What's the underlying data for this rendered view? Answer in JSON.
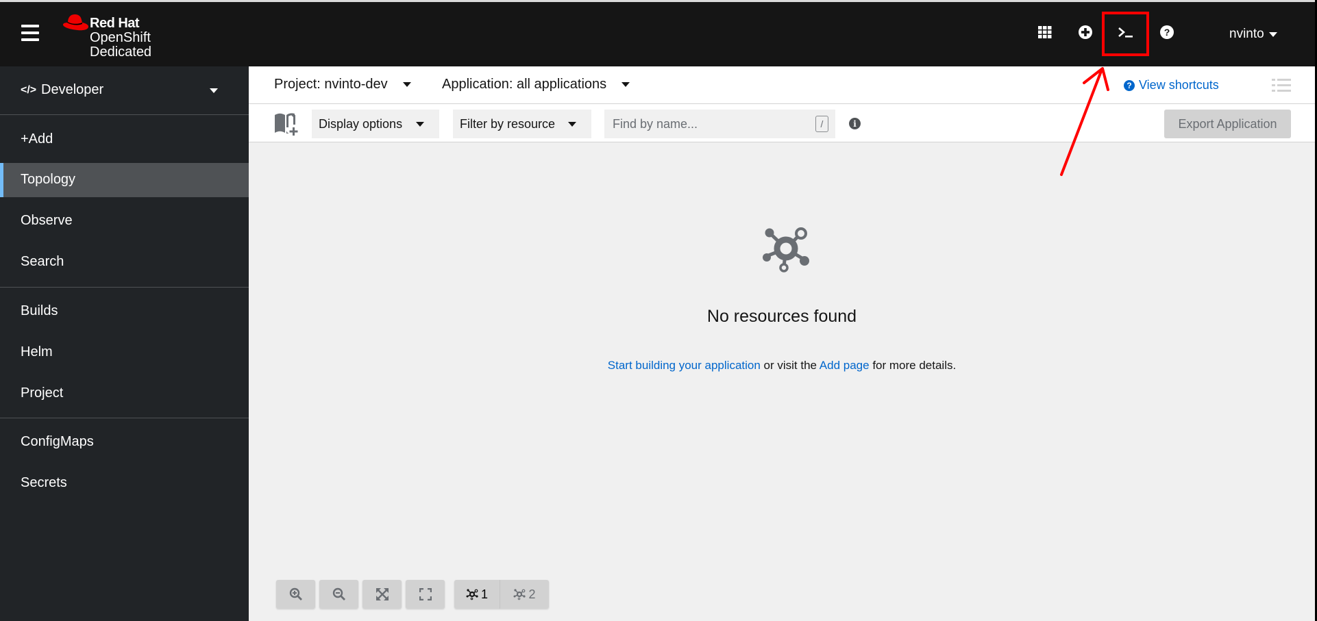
{
  "masthead": {
    "brand": "Red Hat",
    "product": "OpenShift",
    "edition": "Dedicated",
    "icons": [
      "app-launcher-icon",
      "import-add-icon",
      "cloud-shell-terminal-icon",
      "help-icon"
    ],
    "user": "nvinto"
  },
  "sidebar": {
    "perspective": "Developer",
    "items": [
      {
        "label": "+Add",
        "active": false
      },
      {
        "label": "Topology",
        "active": true
      },
      {
        "label": "Observe",
        "active": false
      },
      {
        "label": "Search",
        "active": false
      },
      {
        "label": "Builds",
        "active": false
      },
      {
        "label": "Helm",
        "active": false
      },
      {
        "label": "Project",
        "active": false
      },
      {
        "label": "ConfigMaps",
        "active": false
      },
      {
        "label": "Secrets",
        "active": false
      }
    ]
  },
  "context": {
    "project": "Project: nvinto-dev",
    "application": "Application: all applications",
    "shortcuts": "View shortcuts"
  },
  "toolbar": {
    "display_options": "Display options",
    "filter_by_resource": "Filter by resource",
    "search_placeholder": "Find by name...",
    "search_shortcut": "/",
    "export": "Export Application"
  },
  "empty_state": {
    "title": "No resources found",
    "link1": "Start building your application",
    "mid_text": " or visit the ",
    "link2": "Add page",
    "end_text": " for more details."
  },
  "controls": {
    "buttons": [
      "zoom-in",
      "zoom-out",
      "fit-to-screen",
      "reset-view"
    ],
    "layout1": "1",
    "layout2": "2"
  },
  "colors": {
    "masthead_bg": "#151515",
    "sidebar_bg": "#212427",
    "active_nav_bg": "#4f5255",
    "active_indicator": "#73bcf7",
    "link": "#0066cc",
    "annotation": "#ff0000"
  }
}
